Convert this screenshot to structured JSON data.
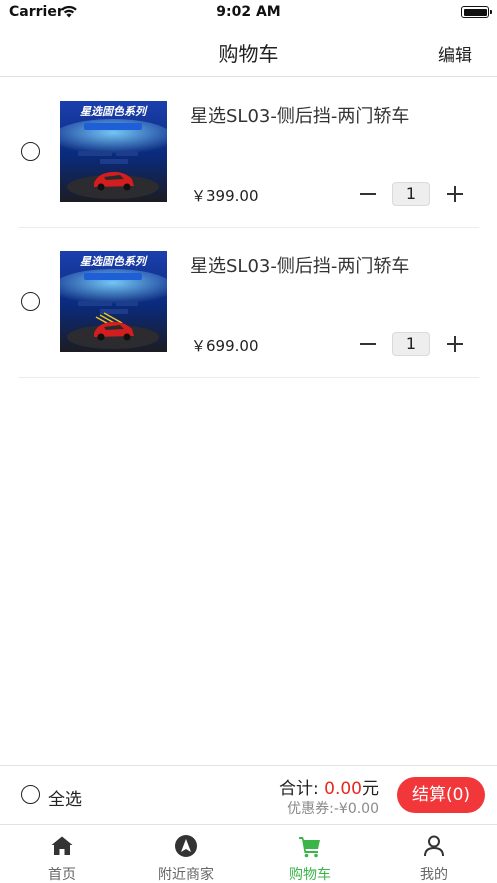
{
  "status_bar": {
    "carrier": "Carrier",
    "time": "9:02 AM"
  },
  "nav": {
    "title": "购物车",
    "edit_label": "编辑"
  },
  "cart": {
    "items": [
      {
        "name": "星选SL03-侧后挡-两门轿车",
        "price": "￥399.00",
        "quantity": "1",
        "image_caption": "星选固色系列",
        "checked": false
      },
      {
        "name": "星选SL03-侧后挡-两门轿车",
        "price": "￥699.00",
        "quantity": "1",
        "image_caption": "星选固色系列",
        "checked": false
      }
    ]
  },
  "checkout": {
    "select_all_label": "全选",
    "total_label": "合计: ",
    "total_amount": "0.00",
    "total_unit": "元",
    "coupon_text": "优惠券:-¥0.00",
    "checkout_button": "结算(0)"
  },
  "tabs": [
    {
      "label": "首页",
      "icon": "home-icon",
      "active": false
    },
    {
      "label": "附近商家",
      "icon": "navigation-compass-icon",
      "active": false
    },
    {
      "label": "购物车",
      "icon": "cart-icon",
      "active": true
    },
    {
      "label": "我的",
      "icon": "user-icon",
      "active": false
    }
  ],
  "colors": {
    "accent_green": "#3bb54a",
    "price_red": "#e8281e",
    "checkout_red": "#f2373a"
  }
}
